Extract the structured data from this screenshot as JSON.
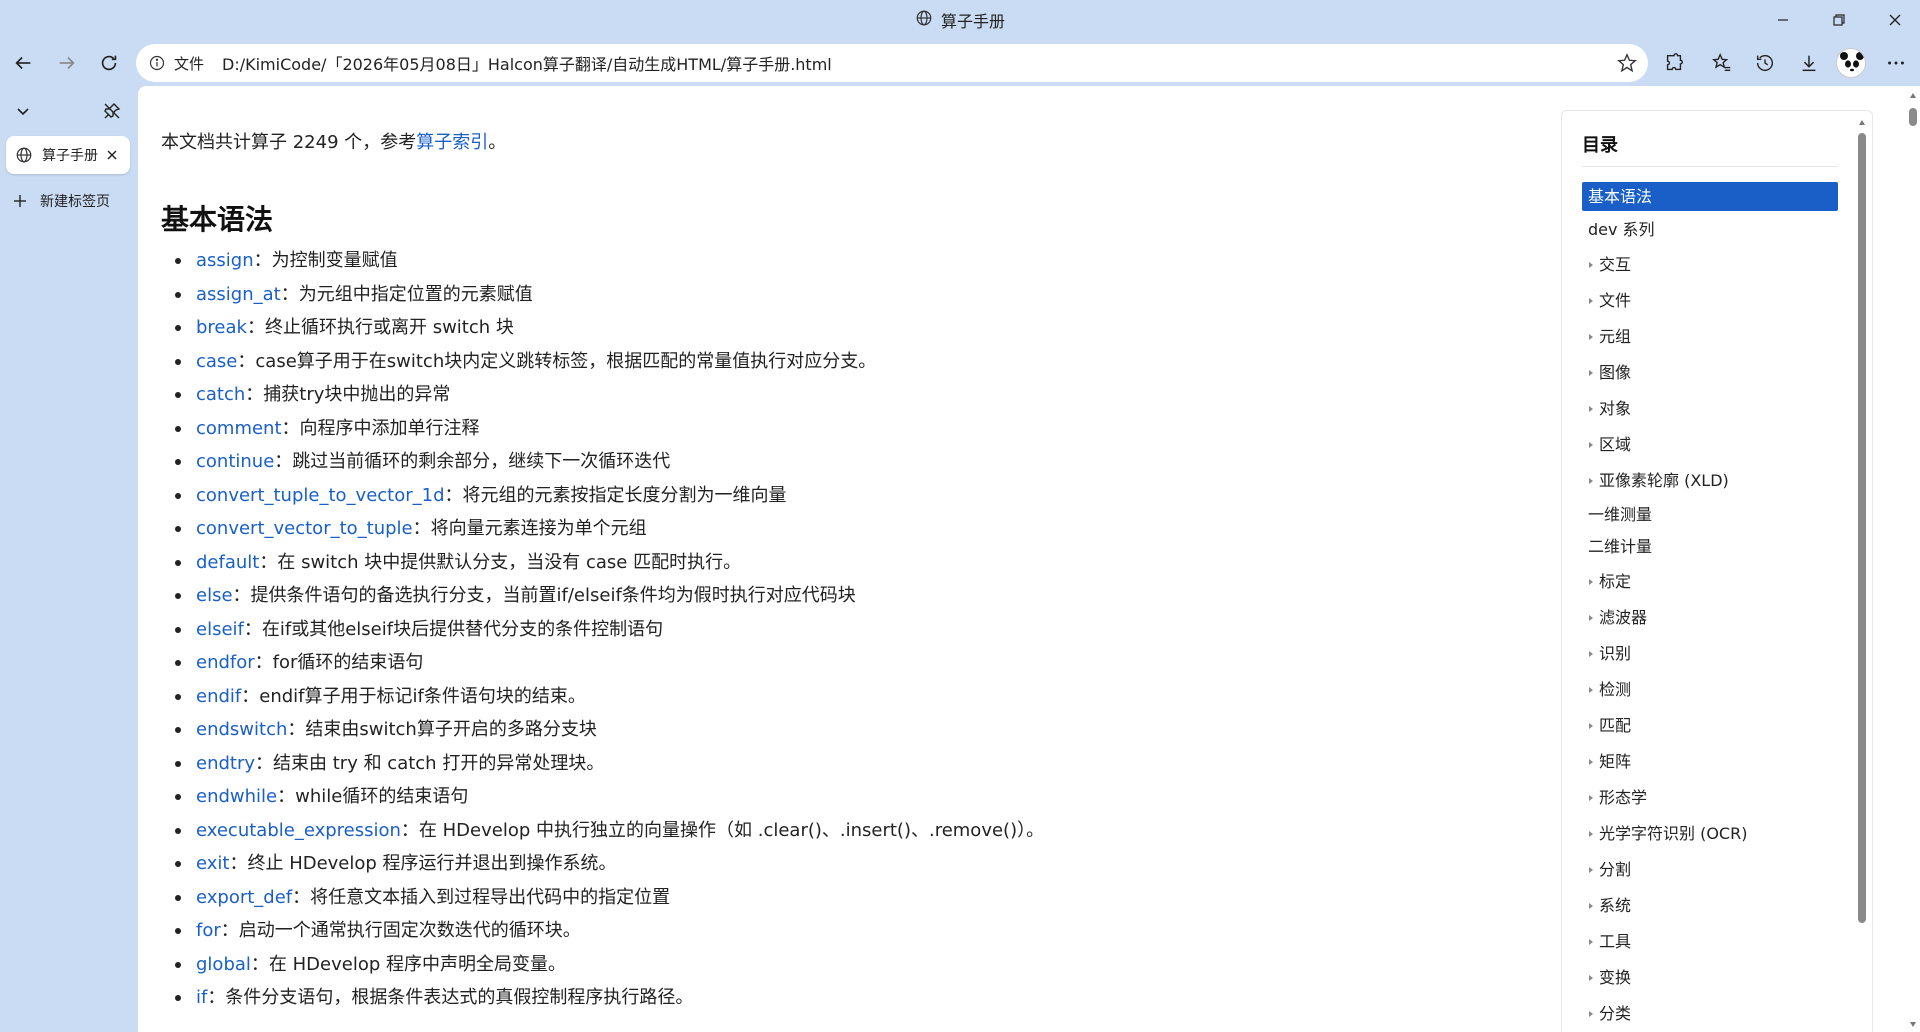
{
  "window": {
    "title": "算子手册",
    "minimize_icon": "minimize-icon",
    "maximize_icon": "restore-icon",
    "close_icon": "close-icon"
  },
  "nav": {
    "address_scheme": "文件",
    "address_url": "D:/KimiCode/「2026年05月08日」Halcon算子翻译/自动生成HTML/算子手册.html"
  },
  "tabs": {
    "active_label": "算子手册",
    "new_tab_label": "新建标签页"
  },
  "page": {
    "intro_prefix": "本文档共计算子 2249 个，参考",
    "intro_link": "算子索引",
    "intro_suffix": "。",
    "section_title": "基本语法",
    "operators": [
      {
        "name": "assign",
        "desc": "：为控制变量赋值"
      },
      {
        "name": "assign_at",
        "desc": "：为元组中指定位置的元素赋值"
      },
      {
        "name": "break",
        "desc": "：终止循环执行或离开 switch 块"
      },
      {
        "name": "case",
        "desc": "：case算子用于在switch块内定义跳转标签，根据匹配的常量值执行对应分支。"
      },
      {
        "name": "catch",
        "desc": "：捕获try块中抛出的异常"
      },
      {
        "name": "comment",
        "desc": "：向程序中添加单行注释"
      },
      {
        "name": "continue",
        "desc": "：跳过当前循环的剩余部分，继续下一次循环迭代"
      },
      {
        "name": "convert_tuple_to_vector_1d",
        "desc": "：将元组的元素按指定长度分割为一维向量"
      },
      {
        "name": "convert_vector_to_tuple",
        "desc": "：将向量元素连接为单个元组"
      },
      {
        "name": "default",
        "desc": "：在 switch 块中提供默认分支，当没有 case 匹配时执行。"
      },
      {
        "name": "else",
        "desc": "：提供条件语句的备选执行分支，当前置if/elseif条件均为假时执行对应代码块"
      },
      {
        "name": "elseif",
        "desc": "：在if或其他elseif块后提供替代分支的条件控制语句"
      },
      {
        "name": "endfor",
        "desc": "：for循环的结束语句"
      },
      {
        "name": "endif",
        "desc": "：endif算子用于标记if条件语句块的结束。"
      },
      {
        "name": "endswitch",
        "desc": "：结束由switch算子开启的多路分支块"
      },
      {
        "name": "endtry",
        "desc": "：结束由 try 和 catch 打开的异常处理块。"
      },
      {
        "name": "endwhile",
        "desc": "：while循环的结束语句"
      },
      {
        "name": "executable_expression",
        "desc": "：在 HDevelop 中执行独立的向量操作（如 .clear()、.insert()、.remove()）。"
      },
      {
        "name": "exit",
        "desc": "：终止 HDevelop 程序运行并退出到操作系统。"
      },
      {
        "name": "export_def",
        "desc": "：将任意文本插入到过程导出代码中的指定位置"
      },
      {
        "name": "for",
        "desc": "：启动一个通常执行固定次数迭代的循环块。"
      },
      {
        "name": "global",
        "desc": "：在 HDevelop 程序中声明全局变量。"
      },
      {
        "name": "if",
        "desc": "：条件分支语句，根据条件表达式的真假控制程序执行路径。"
      }
    ]
  },
  "toc": {
    "title": "目录",
    "items": [
      {
        "label": "基本语法",
        "kind": "active"
      },
      {
        "label": "dev 系列",
        "kind": "plain"
      },
      {
        "label": "交互",
        "kind": "sub"
      },
      {
        "label": "文件",
        "kind": "sub"
      },
      {
        "label": "元组",
        "kind": "sub"
      },
      {
        "label": "图像",
        "kind": "sub"
      },
      {
        "label": "对象",
        "kind": "sub"
      },
      {
        "label": "区域",
        "kind": "sub"
      },
      {
        "label": "亚像素轮廓 (XLD)",
        "kind": "sub"
      },
      {
        "label": "一维测量",
        "kind": "plain"
      },
      {
        "label": "二维计量",
        "kind": "plain"
      },
      {
        "label": "标定",
        "kind": "sub"
      },
      {
        "label": "滤波器",
        "kind": "sub"
      },
      {
        "label": "识别",
        "kind": "sub"
      },
      {
        "label": "检测",
        "kind": "sub"
      },
      {
        "label": "匹配",
        "kind": "sub"
      },
      {
        "label": "矩阵",
        "kind": "sub"
      },
      {
        "label": "形态学",
        "kind": "sub"
      },
      {
        "label": "光学字符识别 (OCR)",
        "kind": "sub"
      },
      {
        "label": "分割",
        "kind": "sub"
      },
      {
        "label": "系统",
        "kind": "sub"
      },
      {
        "label": "工具",
        "kind": "sub"
      },
      {
        "label": "变换",
        "kind": "sub"
      },
      {
        "label": "分类",
        "kind": "sub"
      }
    ]
  },
  "colors": {
    "chrome_bg": "#c9dcf3",
    "link": "#1a5fc8",
    "toc_active_bg": "#1a5fc8"
  }
}
